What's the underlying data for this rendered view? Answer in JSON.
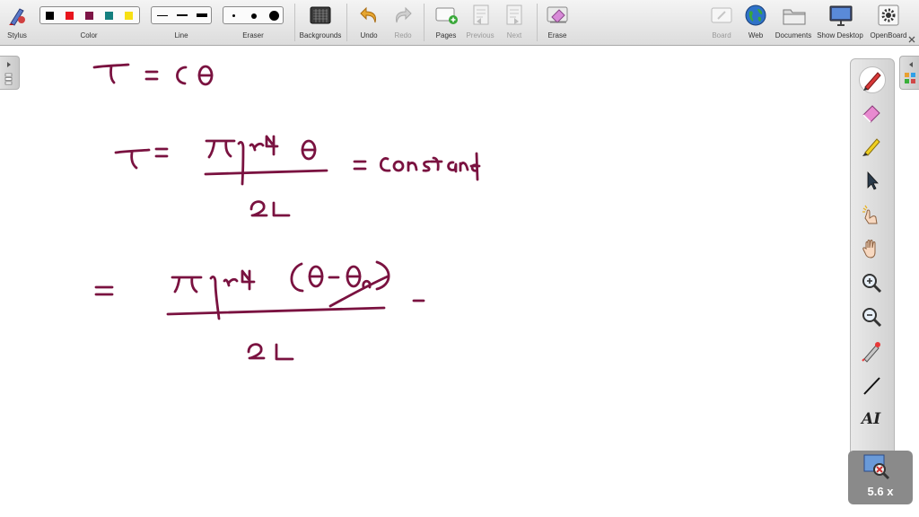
{
  "toolbar": {
    "stylus": "Stylus",
    "color": "Color",
    "line": "Line",
    "eraser": "Eraser",
    "backgrounds": "Backgrounds",
    "undo": "Undo",
    "redo": "Redo",
    "pages": "Pages",
    "previous": "Previous",
    "next": "Next",
    "erase": "Erase",
    "board": "Board",
    "web": "Web",
    "documents": "Documents",
    "show_desktop": "Show Desktop",
    "openboard": "OpenBoard"
  },
  "colors": {
    "swatches": [
      "#000000",
      "#e8141c",
      "#7d1446",
      "#147f7f",
      "#f7e014"
    ],
    "ink": "#7a1240",
    "selected_swatch": "#7d1446"
  },
  "palette": {
    "tools": [
      "pen-icon",
      "eraser-icon",
      "marker-icon",
      "selector-icon",
      "play-icon",
      "hand-icon",
      "zoom-in-icon",
      "zoom-out-icon",
      "laser-pointer-icon",
      "line-icon",
      "text-icon",
      "capture-icon"
    ],
    "text_tool_glyph": "AI"
  },
  "zoom": {
    "label": "5.6 x"
  }
}
